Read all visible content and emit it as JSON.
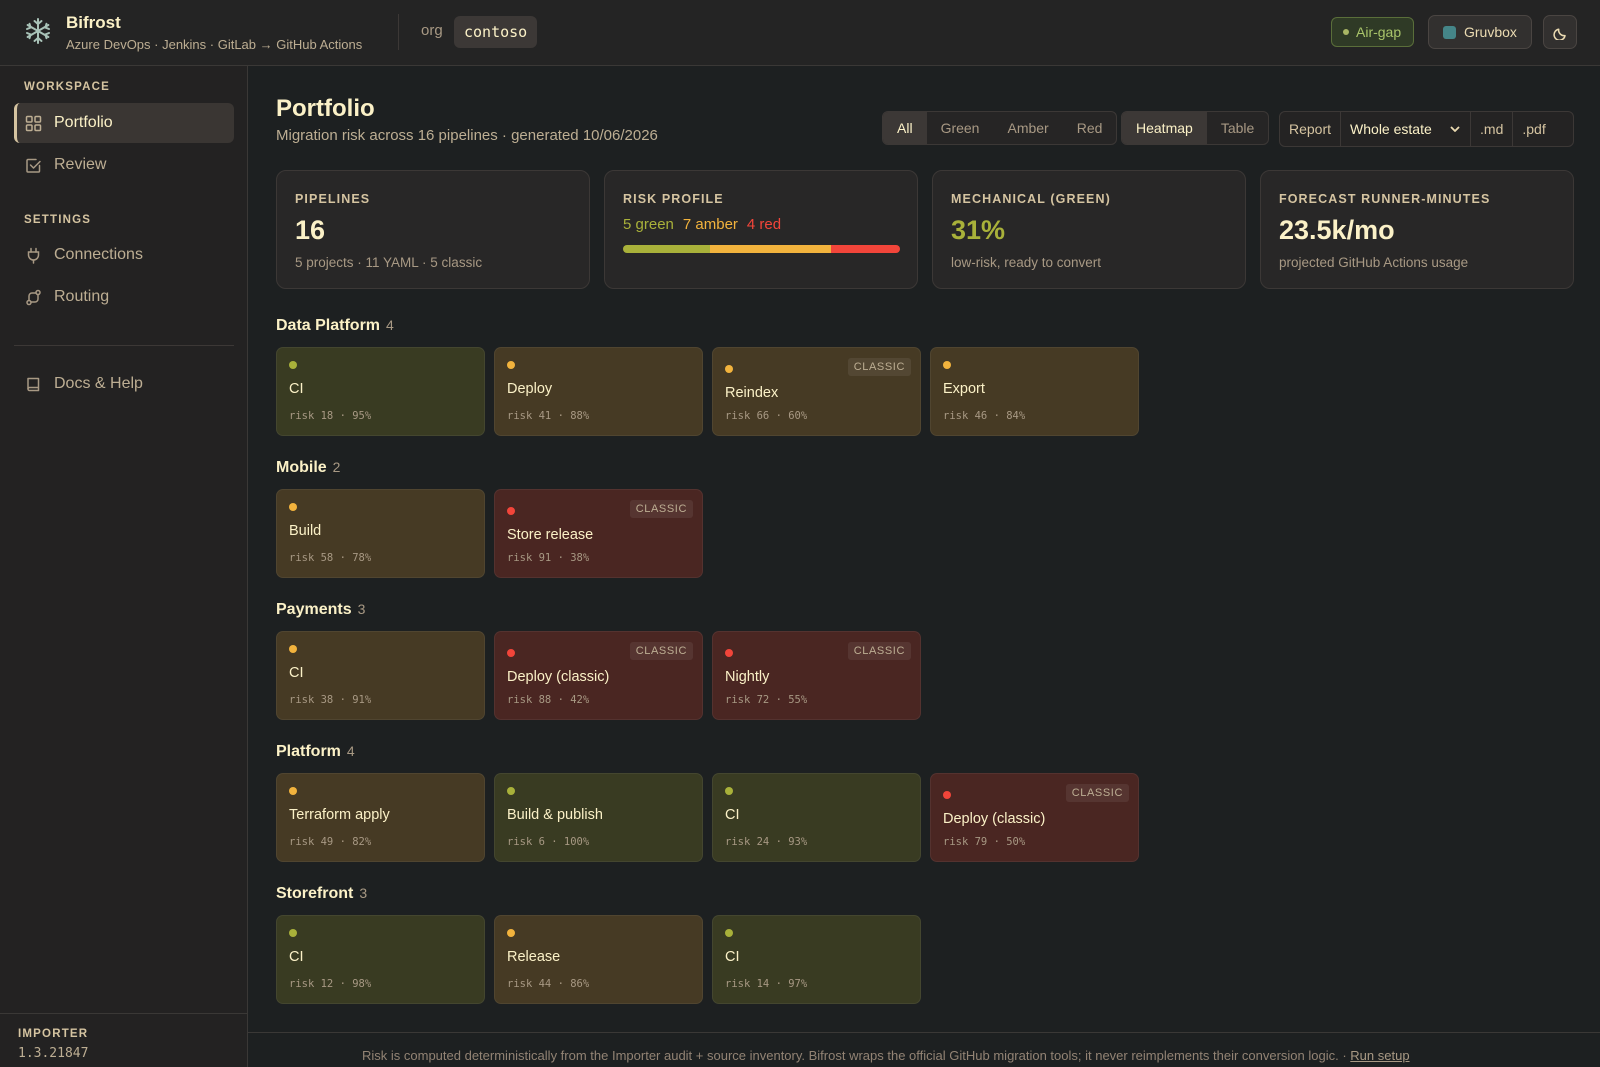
{
  "app": {
    "name": "Bifrost",
    "subtitle": "Azure DevOps · Jenkins · GitLab → GitHub Actions",
    "org_label": "org",
    "org_value": "contoso",
    "airgap_label": "Air-gap",
    "theme_label": "Gruvbox",
    "logo_icon": "snowflake-icon",
    "theme_toggle_icon": "moon-icon"
  },
  "sidebar": {
    "workspace_heading": "WORKSPACE",
    "settings_heading": "SETTINGS",
    "items": [
      {
        "label": "Portfolio",
        "icon": "grid-icon",
        "active": true
      },
      {
        "label": "Review",
        "icon": "checkbox-icon"
      },
      {
        "label": "Connections",
        "icon": "plug-icon"
      },
      {
        "label": "Routing",
        "icon": "route-icon"
      },
      {
        "label": "Docs & Help",
        "icon": "book-icon"
      }
    ],
    "importer_label": "IMPORTER",
    "importer_version": "1.3.21847"
  },
  "page": {
    "title": "Portfolio",
    "subtitle": "Migration risk across 16 pipelines · generated 10/06/2026"
  },
  "filters": {
    "options": [
      "All",
      "Green",
      "Amber",
      "Red"
    ],
    "selected": "All"
  },
  "views": {
    "options": [
      "Heatmap",
      "Table"
    ],
    "selected": "Heatmap"
  },
  "report": {
    "label": "Report",
    "scope": "Whole estate",
    "md": ".md",
    "pdf": ".pdf"
  },
  "stats": {
    "pipelines": {
      "label": "PIPELINES",
      "value": "16",
      "note": "5 projects · 11 YAML · 5 classic"
    },
    "risk": {
      "label": "RISK PROFILE",
      "green": "5 green",
      "amber": "7 amber",
      "red": "4 red",
      "green_n": 5,
      "amber_n": 7,
      "red_n": 4
    },
    "mechanical": {
      "label": "MECHANICAL (GREEN)",
      "value": "31%",
      "note": "low-risk, ready to convert"
    },
    "forecast": {
      "label": "FORECAST RUNNER-MINUTES",
      "value": "23.5k/mo",
      "note": "projected GitHub Actions usage"
    }
  },
  "colors": {
    "green": "#a9b13a",
    "amber": "#f2b33d",
    "red": "#f2453a"
  },
  "groups": [
    {
      "name": "Data Platform",
      "count": "4",
      "tiles": [
        {
          "name": "CI",
          "meta": "risk 18 · 95%",
          "level": "green"
        },
        {
          "name": "Deploy",
          "meta": "risk 41 · 88%",
          "level": "amber"
        },
        {
          "name": "Reindex",
          "meta": "risk 66 · 60%",
          "level": "amber",
          "badge": "CLASSIC"
        },
        {
          "name": "Export",
          "meta": "risk 46 · 84%",
          "level": "amber"
        }
      ]
    },
    {
      "name": "Mobile",
      "count": "2",
      "tiles": [
        {
          "name": "Build",
          "meta": "risk 58 · 78%",
          "level": "amber"
        },
        {
          "name": "Store release",
          "meta": "risk 91 · 38%",
          "level": "red",
          "badge": "CLASSIC"
        }
      ]
    },
    {
      "name": "Payments",
      "count": "3",
      "tiles": [
        {
          "name": "CI",
          "meta": "risk 38 · 91%",
          "level": "amber"
        },
        {
          "name": "Deploy (classic)",
          "meta": "risk 88 · 42%",
          "level": "red",
          "badge": "CLASSIC"
        },
        {
          "name": "Nightly",
          "meta": "risk 72 · 55%",
          "level": "red",
          "badge": "CLASSIC"
        }
      ]
    },
    {
      "name": "Platform",
      "count": "4",
      "tiles": [
        {
          "name": "Terraform apply",
          "meta": "risk 49 · 82%",
          "level": "amber"
        },
        {
          "name": "Build & publish",
          "meta": "risk 6 · 100%",
          "level": "green"
        },
        {
          "name": "CI",
          "meta": "risk 24 · 93%",
          "level": "green"
        },
        {
          "name": "Deploy (classic)",
          "meta": "risk 79 · 50%",
          "level": "red",
          "badge": "CLASSIC"
        }
      ]
    },
    {
      "name": "Storefront",
      "count": "3",
      "tiles": [
        {
          "name": "CI",
          "meta": "risk 12 · 98%",
          "level": "green"
        },
        {
          "name": "Release",
          "meta": "risk 44 · 86%",
          "level": "amber"
        },
        {
          "name": "CI",
          "meta": "risk 14 · 97%",
          "level": "green"
        }
      ]
    }
  ],
  "footer": {
    "text": "Risk is computed deterministically from the Importer audit + source inventory. Bifrost wraps the official GitHub migration tools; it never reimplements their conversion logic. ·",
    "link": "Run setup"
  }
}
